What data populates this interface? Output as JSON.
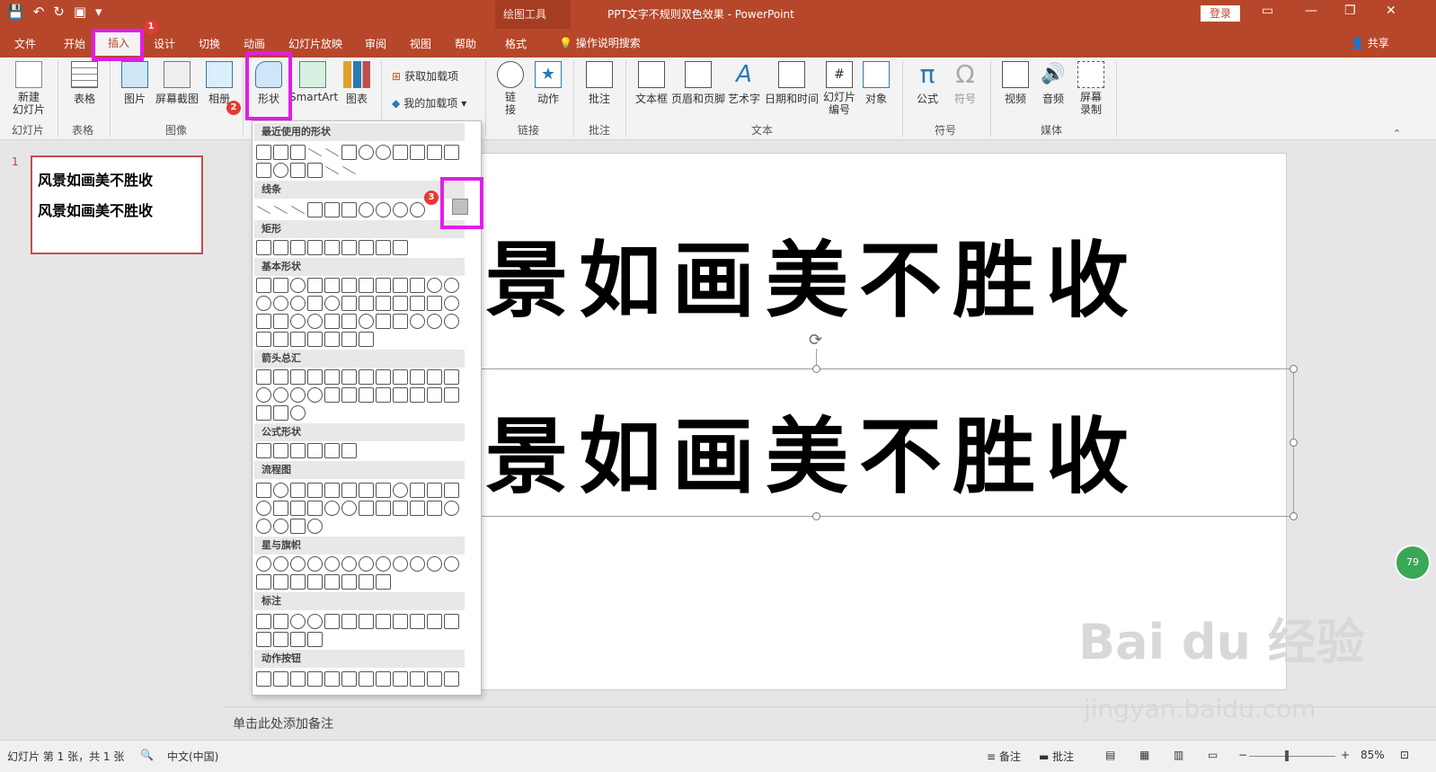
{
  "titlebar": {
    "context_tools": "绘图工具",
    "doc_title": "PPT文字不规则双色效果  -  PowerPoint",
    "login": "登录"
  },
  "tabs": {
    "file": "文件",
    "home": "开始",
    "insert": "插入",
    "design": "设计",
    "transitions": "切换",
    "animations": "动画",
    "slideshow": "幻灯片放映",
    "review": "审阅",
    "view": "视图",
    "help": "帮助",
    "format": "格式",
    "tell_me": "操作说明搜索",
    "share": "共享"
  },
  "ribbon": {
    "new_slide": "新建\n幻灯片",
    "table": "表格",
    "picture": "图片",
    "screenshot": "屏幕截图",
    "album": "相册",
    "shapes": "形状",
    "smartart": "SmartArt",
    "chart": "图表",
    "get_addins": "获取加载项",
    "my_addins": "我的加载项",
    "link": "链\n接",
    "action": "动作",
    "comment": "批注",
    "textbox": "文本框",
    "header_footer": "页眉和页脚",
    "wordart": "艺术字",
    "datetime": "日期和时间",
    "slide_number": "幻灯片\n编号",
    "object": "对象",
    "equation": "公式",
    "symbol": "符号",
    "video": "视频",
    "audio": "音频",
    "screen_record": "屏幕\n录制",
    "groups": {
      "slides": "幻灯片",
      "tables": "表格",
      "images": "图像",
      "links": "链接",
      "comments": "批注",
      "text": "文本",
      "symbols": "符号",
      "media": "媒体"
    }
  },
  "badges": [
    "1",
    "2",
    "3"
  ],
  "thumb": {
    "num": "1",
    "line1": "风景如画美不胜收",
    "line2": "风景如画美不胜收"
  },
  "slide": {
    "line1": "景如画美不胜收",
    "line2": "景如画美不胜收"
  },
  "dropdown": {
    "recent": "最近使用的形状",
    "lines": "线条",
    "rect": "矩形",
    "basic": "基本形状",
    "arrows": "箭头总汇",
    "equation": "公式形状",
    "flowchart": "流程图",
    "stars": "星与旗帜",
    "callouts": "标注",
    "actions": "动作按钮"
  },
  "notes": "单击此处添加备注",
  "status": {
    "slide_info": "幻灯片 第 1 张，共 1 张",
    "lang": "中文(中国)",
    "notes_btn": "备注",
    "comments_btn": "批注",
    "zoom": "85%"
  },
  "watermark": {
    "brand": "Bai du 经验",
    "url": "jingyan.baidu.com"
  },
  "green_ball": "79",
  "colors": {
    "accent": "#b7472a",
    "highlight": "#e11de8",
    "badge": "#e53935"
  }
}
